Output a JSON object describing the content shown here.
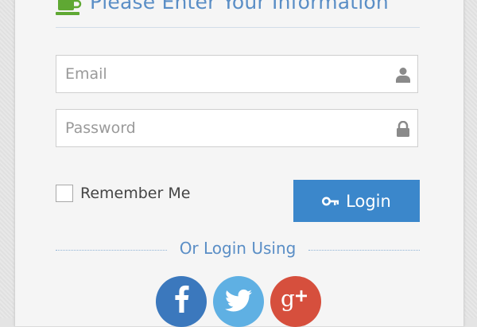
{
  "form": {
    "heading": "Please Enter Your Information",
    "email_placeholder": "Email",
    "password_placeholder": "Password",
    "remember_label": "Remember Me",
    "login_label": "Login",
    "or_text": "Or Login Using"
  },
  "icons": {
    "heading": "coffee-cup-icon",
    "email": "user-icon",
    "password": "lock-icon",
    "login": "key-icon"
  },
  "social": [
    {
      "name": "facebook",
      "icon": "facebook-icon",
      "color": "#3b78bd"
    },
    {
      "name": "twitter",
      "icon": "twitter-icon",
      "color": "#5fb0e3"
    },
    {
      "name": "google-plus",
      "icon": "google-plus-icon",
      "color": "#d64f3d"
    }
  ],
  "colors": {
    "accent": "#5a8ec6",
    "button": "#3b87cb",
    "cup_icon": "#5fa833"
  }
}
